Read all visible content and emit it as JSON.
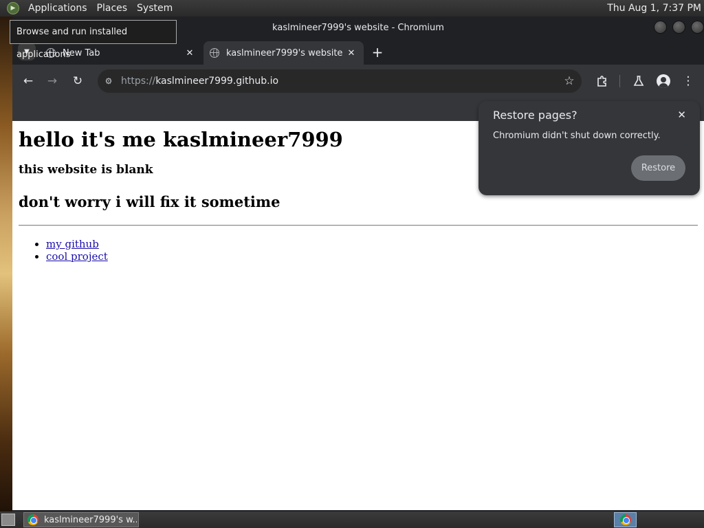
{
  "desktop": {
    "top_panel": {
      "menus": [
        "Applications",
        "Places",
        "System"
      ],
      "clock": "Thu Aug  1,  7:37 PM"
    },
    "tooltip": "Browse and run installed applications",
    "taskbar": {
      "window_label": "kaslmineer7999's w..."
    }
  },
  "browser": {
    "window_title": "kaslmineer7999's website - Chromium",
    "tabs": [
      {
        "title": "New Tab",
        "active": false
      },
      {
        "title": "kaslmineer7999's website",
        "active": true
      }
    ],
    "omnibox": {
      "scheme": "https://",
      "host": "kaslmineer7999.github.io"
    },
    "restore_popup": {
      "title": "Restore pages?",
      "message": "Chromium didn't shut down correctly.",
      "button": "Restore"
    }
  },
  "page": {
    "heading": "hello it's me kaslmineer7999",
    "subheading": "this website is blank",
    "second_heading": "don't worry i will fix it sometime",
    "links": [
      "my github",
      "cool project"
    ]
  },
  "icons": {
    "tab_list": "chevron-down-icon",
    "tab_favicon": "globe-icon",
    "tab_close": "close-icon",
    "new_tab": "plus-icon",
    "back": "arrow-left-icon",
    "forward": "arrow-right-icon",
    "reload": "reload-icon",
    "site_info": "tune-icon",
    "bookmark": "star-icon",
    "extensions": "puzzle-icon",
    "labs": "flask-icon",
    "profile": "avatar-icon",
    "menu": "kebab-menu-icon"
  },
  "colors": {
    "browser_dark": "#202124",
    "toolbar": "#35363a",
    "link": "#1a0dab",
    "page_bg": "#ffffff"
  }
}
